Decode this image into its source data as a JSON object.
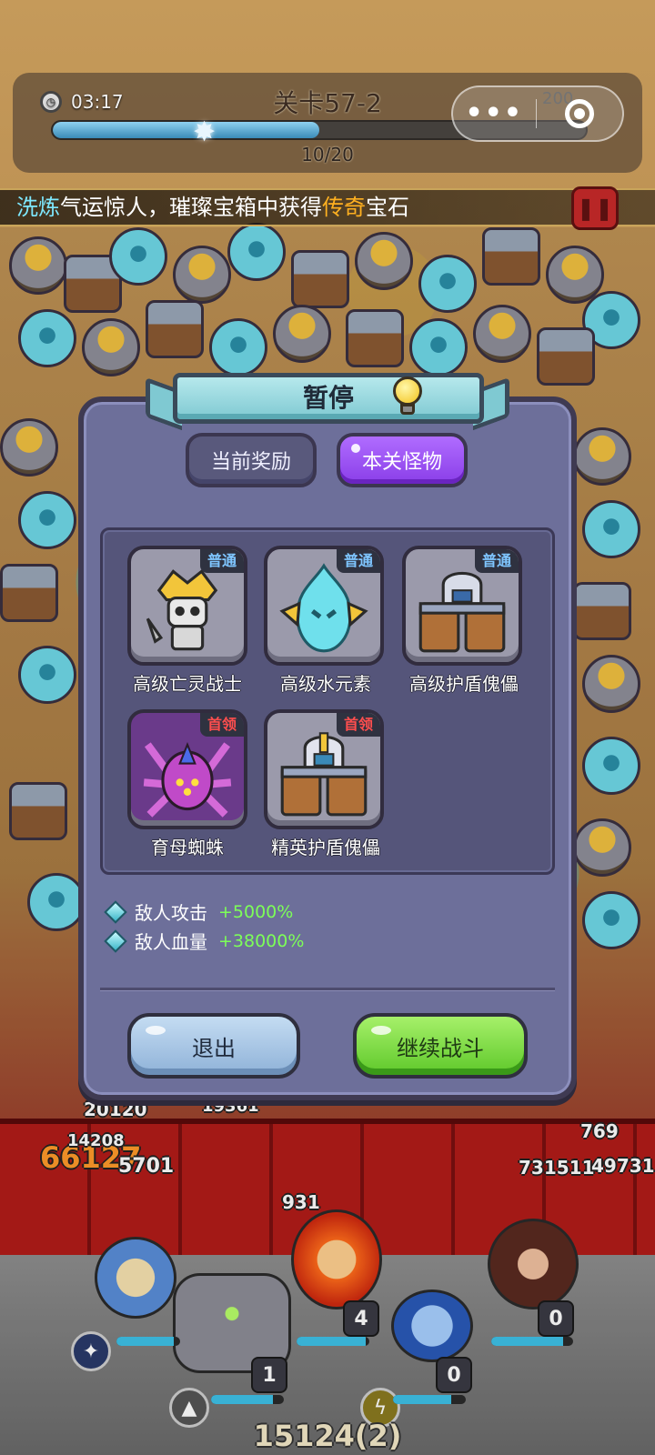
{
  "hud": {
    "timer": "03:17",
    "level_title": "关卡57-2",
    "progress_text": "10/20",
    "progress": 0.5,
    "kills": "200"
  },
  "capsule": {
    "menu_dots": "•••"
  },
  "banner": {
    "prefix": "洗炼",
    "part1": "气运惊人，璀璨宝箱中获得",
    "highlight": "传奇",
    "part2": "宝石"
  },
  "battle": {
    "damage_numbers": [
      "66127",
      "20120",
      "19361",
      "14208",
      "5701",
      "931",
      "769",
      "731511",
      "49731",
      "15124(2)"
    ],
    "hero_levels": [
      "1",
      "4",
      "0",
      "0"
    ]
  },
  "dialog": {
    "title": "暂停",
    "tabs": [
      {
        "label": "当前奖励",
        "active": false
      },
      {
        "label": "本关怪物",
        "active": true
      }
    ],
    "monsters": [
      {
        "name": "高级亡灵战士",
        "tag": "普通",
        "type": "normal",
        "icon": "undead-warrior-icon"
      },
      {
        "name": "高级水元素",
        "tag": "普通",
        "type": "normal",
        "icon": "water-elemental-icon"
      },
      {
        "name": "高级护盾傀儡",
        "tag": "普通",
        "type": "normal",
        "icon": "shield-golem-icon"
      },
      {
        "name": "育母蜘蛛",
        "tag": "首领",
        "type": "boss",
        "icon": "brood-spider-icon"
      },
      {
        "name": "精英护盾傀儡",
        "tag": "首领",
        "type": "boss",
        "icon": "elite-shield-golem-icon"
      }
    ],
    "stats": [
      {
        "label": "敌人攻击",
        "value": "+5000%"
      },
      {
        "label": "敌人血量",
        "value": "+38000%"
      }
    ],
    "buttons": {
      "exit": "退出",
      "continue": "继续战斗"
    }
  },
  "colors": {
    "dialog_bg": "#6d6f9a",
    "active_tab": "#9a4ef2",
    "normal_tag": "#7fc6ff",
    "boss_tag": "#ff4e4e",
    "stat_value": "#7dff58",
    "exit_button": "#a9c8e8",
    "continue_button": "#7ad840"
  }
}
